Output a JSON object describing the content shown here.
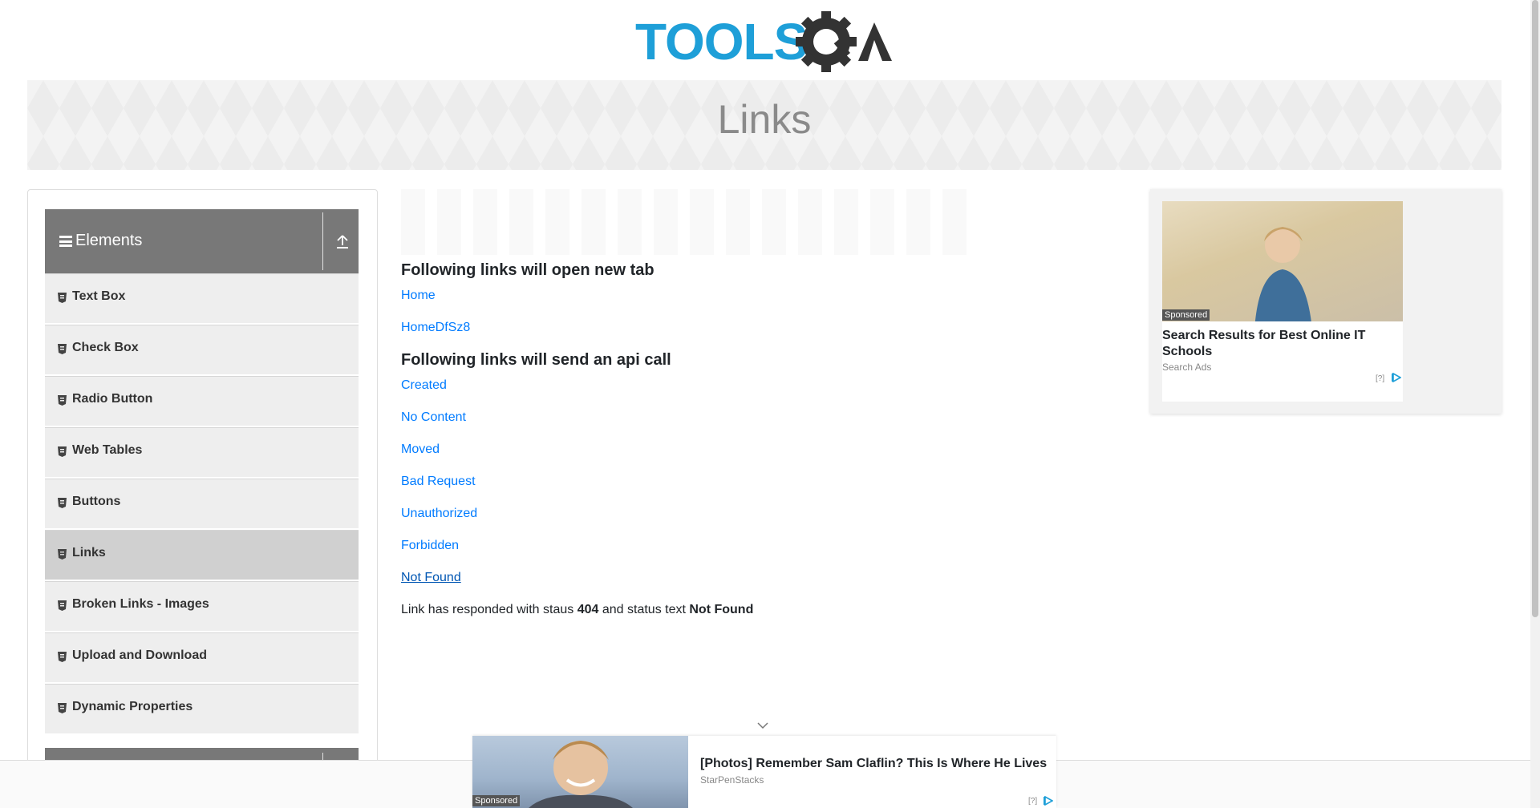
{
  "header": {
    "logo_text": "TOOLSQA"
  },
  "banner": {
    "title": "Links"
  },
  "sidebar": {
    "group_title": "Elements",
    "items": [
      {
        "label": "Text Box"
      },
      {
        "label": "Check Box"
      },
      {
        "label": "Radio Button"
      },
      {
        "label": "Web Tables"
      },
      {
        "label": "Buttons"
      },
      {
        "label": "Links"
      },
      {
        "label": "Broken Links - Images"
      },
      {
        "label": "Upload and Download"
      },
      {
        "label": "Dynamic Properties"
      }
    ],
    "active_item": "Links"
  },
  "main": {
    "section1_title": "Following links will open new tab",
    "new_tab_links": [
      {
        "label": "Home"
      },
      {
        "label": "HomeDfSz8"
      }
    ],
    "section2_title": "Following links will send an api call",
    "api_links": [
      {
        "label": "Created"
      },
      {
        "label": "No Content"
      },
      {
        "label": "Moved"
      },
      {
        "label": "Bad Request"
      },
      {
        "label": "Unauthorized"
      },
      {
        "label": "Forbidden"
      },
      {
        "label": "Not Found"
      }
    ],
    "response": {
      "prefix": "Link has responded with staus",
      "status_code": "404",
      "middle": "and status text",
      "status_text": "Not Found"
    }
  },
  "side_ad": {
    "badge": "Sponsored",
    "title": "Search Results for Best Online IT Schools",
    "source": "Search Ads",
    "info": "[?]"
  },
  "bottom_ad": {
    "badge": "Sponsored",
    "title": "[Photos] Remember Sam Claflin? This Is Where He Lives",
    "source": "StarPenStacks",
    "info": "[?]"
  },
  "colors": {
    "link": "#007bff",
    "logo": "#1e9fd8",
    "sidebar_header": "#787878",
    "sidebar_item": "#eeeeee"
  }
}
